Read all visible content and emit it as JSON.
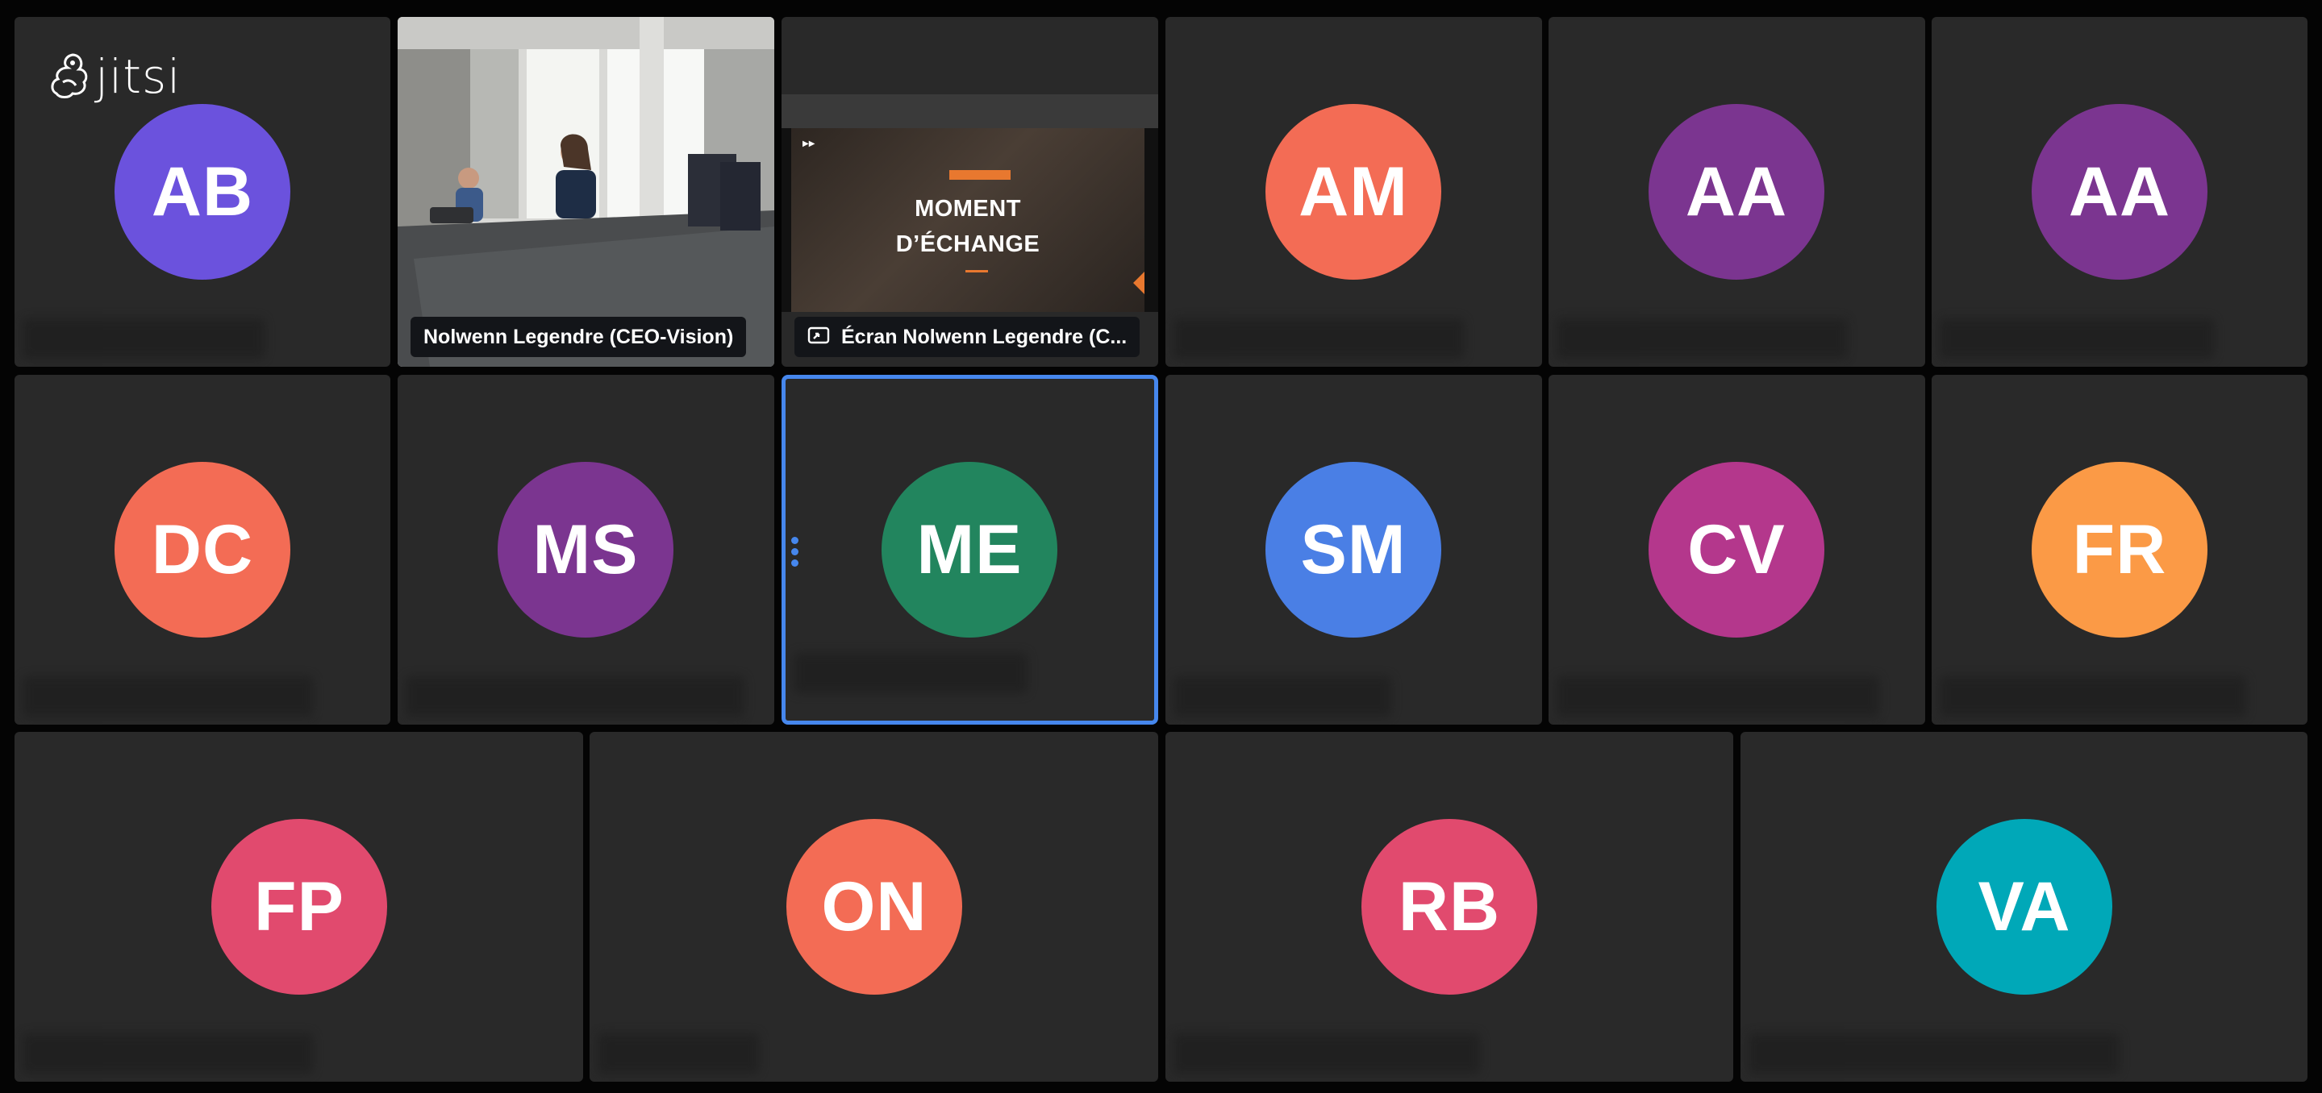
{
  "app": {
    "logo_text": "jitsi"
  },
  "colors": {
    "background": "#040404",
    "tile": "#292929",
    "active_border": "#4687ed",
    "badge_bg": "#131519"
  },
  "tiles": [
    {
      "initials": "AB",
      "color": "#6b52dd"
    },
    {
      "name": "Nolwenn Legendre (CEO-Vision)",
      "type": "camera"
    },
    {
      "name": "Écran Nolwenn Legendre (C...",
      "type": "screenshare",
      "icon": "screen-share-icon",
      "slide": {
        "line1": "MOMENT",
        "line2": "D’ÉCHANGE"
      }
    },
    {
      "initials": "AM",
      "color": "#f36c55"
    },
    {
      "initials": "AA",
      "color": "#7b3590"
    },
    {
      "initials": "AA",
      "color": "#7b3590"
    },
    {
      "initials": "DC",
      "color": "#f36c55"
    },
    {
      "initials": "MS",
      "color": "#7b3590"
    },
    {
      "initials": "ME",
      "color": "#22855e",
      "active": true
    },
    {
      "initials": "SM",
      "color": "#4a7fe5"
    },
    {
      "initials": "CV",
      "color": "#b4378c"
    },
    {
      "initials": "FR",
      "color": "#fb9a46"
    },
    {
      "initials": "FP",
      "color": "#e14a6e"
    },
    {
      "initials": "ON",
      "color": "#f36c55"
    },
    {
      "initials": "RB",
      "color": "#e14a6e"
    },
    {
      "initials": "VA",
      "color": "#00a8b8"
    }
  ]
}
